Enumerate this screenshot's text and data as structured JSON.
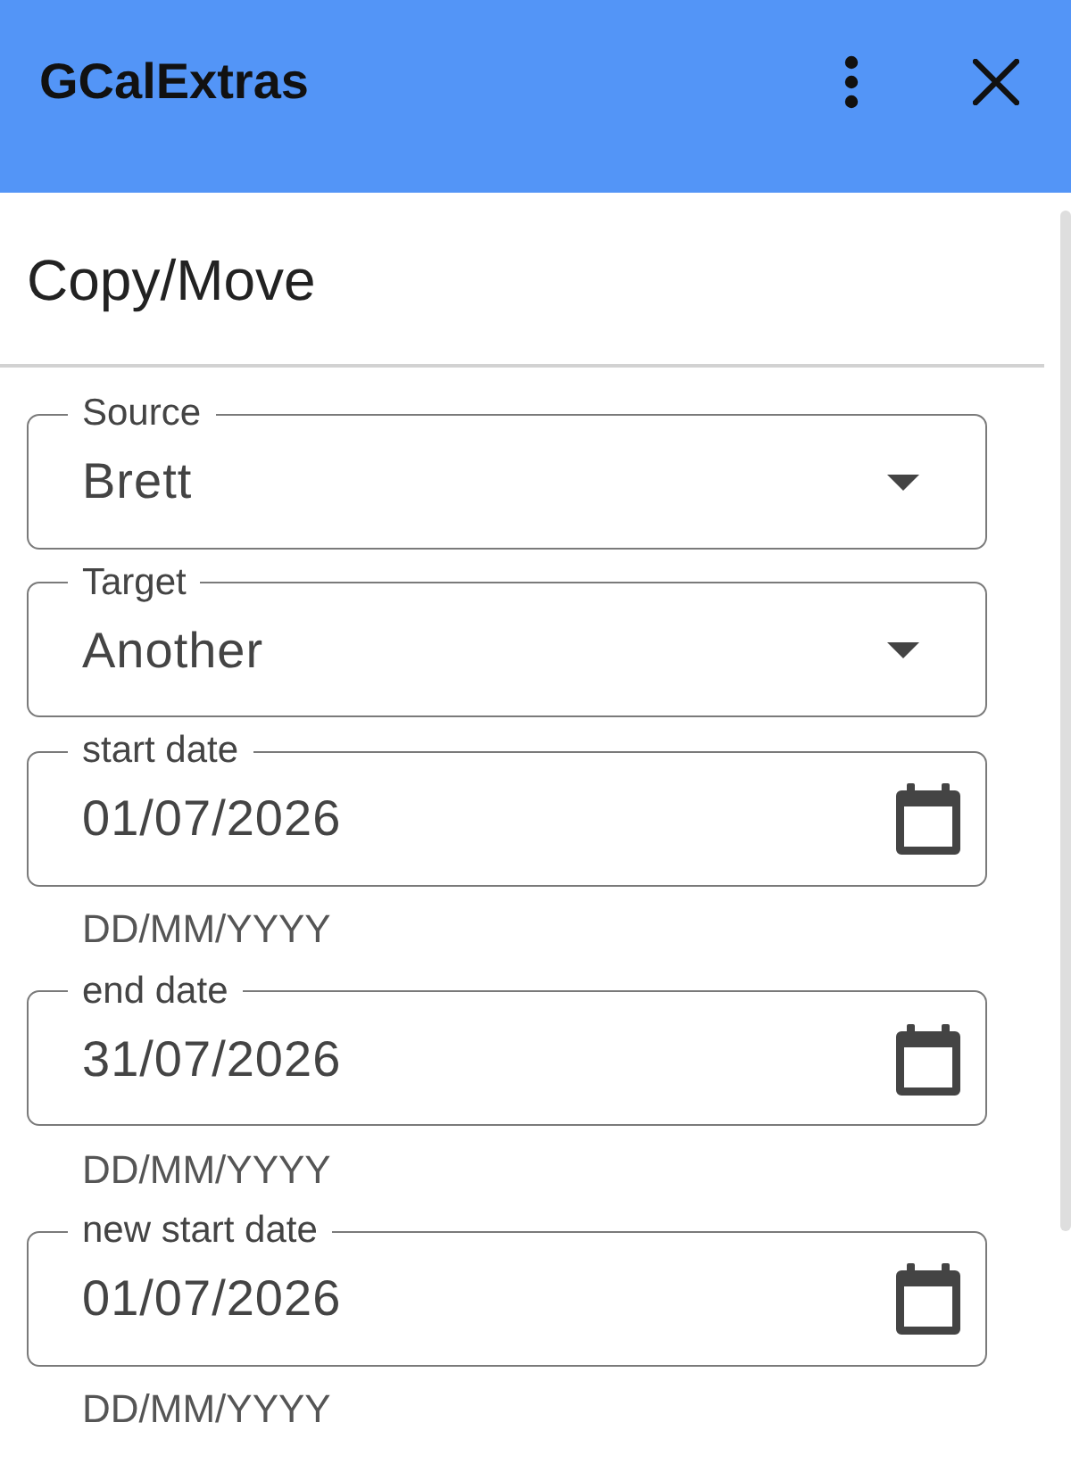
{
  "header": {
    "title": "GCalExtras"
  },
  "section": {
    "title": "Copy/Move"
  },
  "fields": [
    {
      "kind": "select",
      "label": "Source",
      "value": "Brett"
    },
    {
      "kind": "select",
      "label": "Target",
      "value": "Another"
    },
    {
      "kind": "date",
      "label": "start date",
      "value": "01/07/2026",
      "helper": "DD/MM/YYYY"
    },
    {
      "kind": "date",
      "label": "end date",
      "value": "31/07/2026",
      "helper": "DD/MM/YYYY"
    },
    {
      "kind": "date",
      "label": "new start date",
      "value": "01/07/2026",
      "helper": "DD/MM/YYYY"
    }
  ]
}
